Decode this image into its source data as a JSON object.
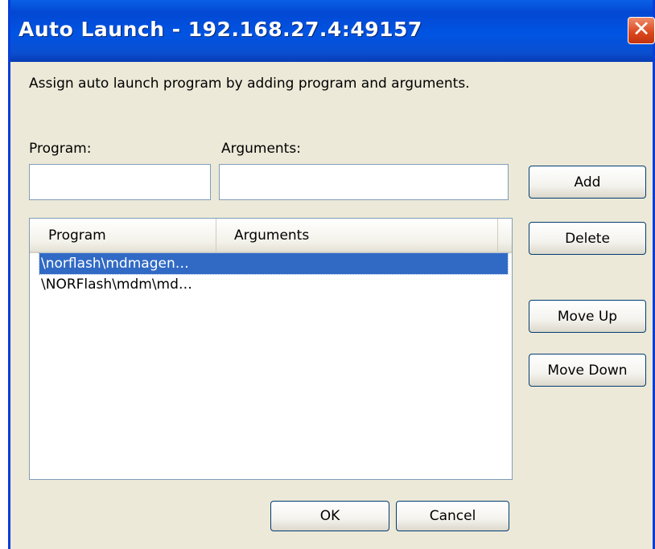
{
  "window": {
    "title": "Auto Launch - 192.168.27.4:49157",
    "close_glyph": "✕"
  },
  "description": "Assign auto launch program by adding program and arguments.",
  "form": {
    "program_label": "Program:",
    "program_value": "",
    "arguments_label": "Arguments:",
    "arguments_value": ""
  },
  "list": {
    "columns": [
      "Program",
      "Arguments"
    ],
    "rows": [
      {
        "program": "\\norflash\\mdmagen…",
        "arguments": "",
        "selected": true
      },
      {
        "program": "\\NORFlash\\mdm\\md…",
        "arguments": "",
        "selected": false
      }
    ]
  },
  "buttons": {
    "add": "Add",
    "delete": "Delete",
    "move_up": "Move Up",
    "move_down": "Move Down",
    "ok": "OK",
    "cancel": "Cancel"
  },
  "colors": {
    "titlebar": "#0054e3",
    "selection": "#316ac5",
    "dialog_bg": "#ece9d8",
    "close_button": "#d9461c"
  }
}
